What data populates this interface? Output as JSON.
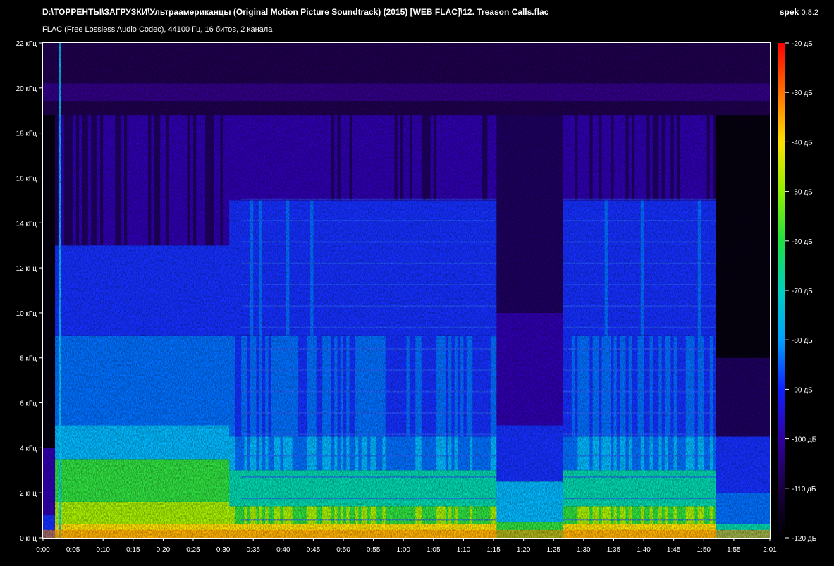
{
  "header": {
    "title": "D:\\ТОРРЕНТЫ\\ЗАГРУЗКИ\\Ультраамериканцы (Original Motion Picture Soundtrack) (2015) [WEB FLAC]\\12. Treason Calls.flac",
    "subtitle": "FLAC (Free Lossless Audio Codec), 44100 Гц, 16 битов, 2 канала",
    "app_name": "spek",
    "app_version": "0.8.2"
  },
  "colors": {
    "background": "#000000",
    "text": "#ffffff",
    "scale_gradient": [
      "#000000",
      "#1a0040",
      "#3000a0",
      "#1020ff",
      "#00b0ff",
      "#00e0b0",
      "#30e030",
      "#b0f000",
      "#ffe000",
      "#ff7000",
      "#ff0000"
    ]
  },
  "chart_data": {
    "type": "heatmap",
    "title": "",
    "xlabel": "",
    "ylabel": "",
    "x_tick_labels": [
      "0:00",
      "0:05",
      "0:10",
      "0:15",
      "0:20",
      "0:25",
      "0:30",
      "0:35",
      "0:40",
      "0:45",
      "0:50",
      "0:55",
      "1:00",
      "1:05",
      "1:10",
      "1:15",
      "1:20",
      "1:25",
      "1:30",
      "1:35",
      "1:40",
      "1:45",
      "1:50",
      "1:55",
      "2:01"
    ],
    "x_tick_seconds": [
      0,
      5,
      10,
      15,
      20,
      25,
      30,
      35,
      40,
      45,
      50,
      55,
      60,
      65,
      70,
      75,
      80,
      85,
      90,
      95,
      100,
      105,
      110,
      115,
      121
    ],
    "xlim": [
      0,
      121
    ],
    "y_tick_labels": [
      "0 кГц",
      "2 кГц",
      "4 кГц",
      "6 кГц",
      "8 кГц",
      "10 кГц",
      "12 кГц",
      "14 кГц",
      "16 кГц",
      "18 кГц",
      "20 кГц",
      "22 кГц"
    ],
    "y_tick_khz": [
      0,
      2,
      4,
      6,
      8,
      10,
      12,
      14,
      16,
      18,
      20,
      22
    ],
    "ylim": [
      0,
      22
    ],
    "colorbar": {
      "labels": [
        "-20 дБ",
        "-30 дБ",
        "-40 дБ",
        "-50 дБ",
        "-60 дБ",
        "-70 дБ",
        "-80 дБ",
        "-90 дБ",
        "-100 дБ",
        "-110 дБ",
        "-120 дБ"
      ],
      "db_values": [
        -20,
        -30,
        -40,
        -50,
        -60,
        -70,
        -80,
        -90,
        -100,
        -110,
        -120
      ],
      "range": [
        -120,
        -20
      ]
    },
    "features": {
      "spectral_cutoff_khz": 18.8,
      "quiet_sections_seconds": [
        [
          0,
          2
        ],
        [
          75.5,
          86.5
        ],
        [
          112,
          121
        ]
      ]
    }
  }
}
